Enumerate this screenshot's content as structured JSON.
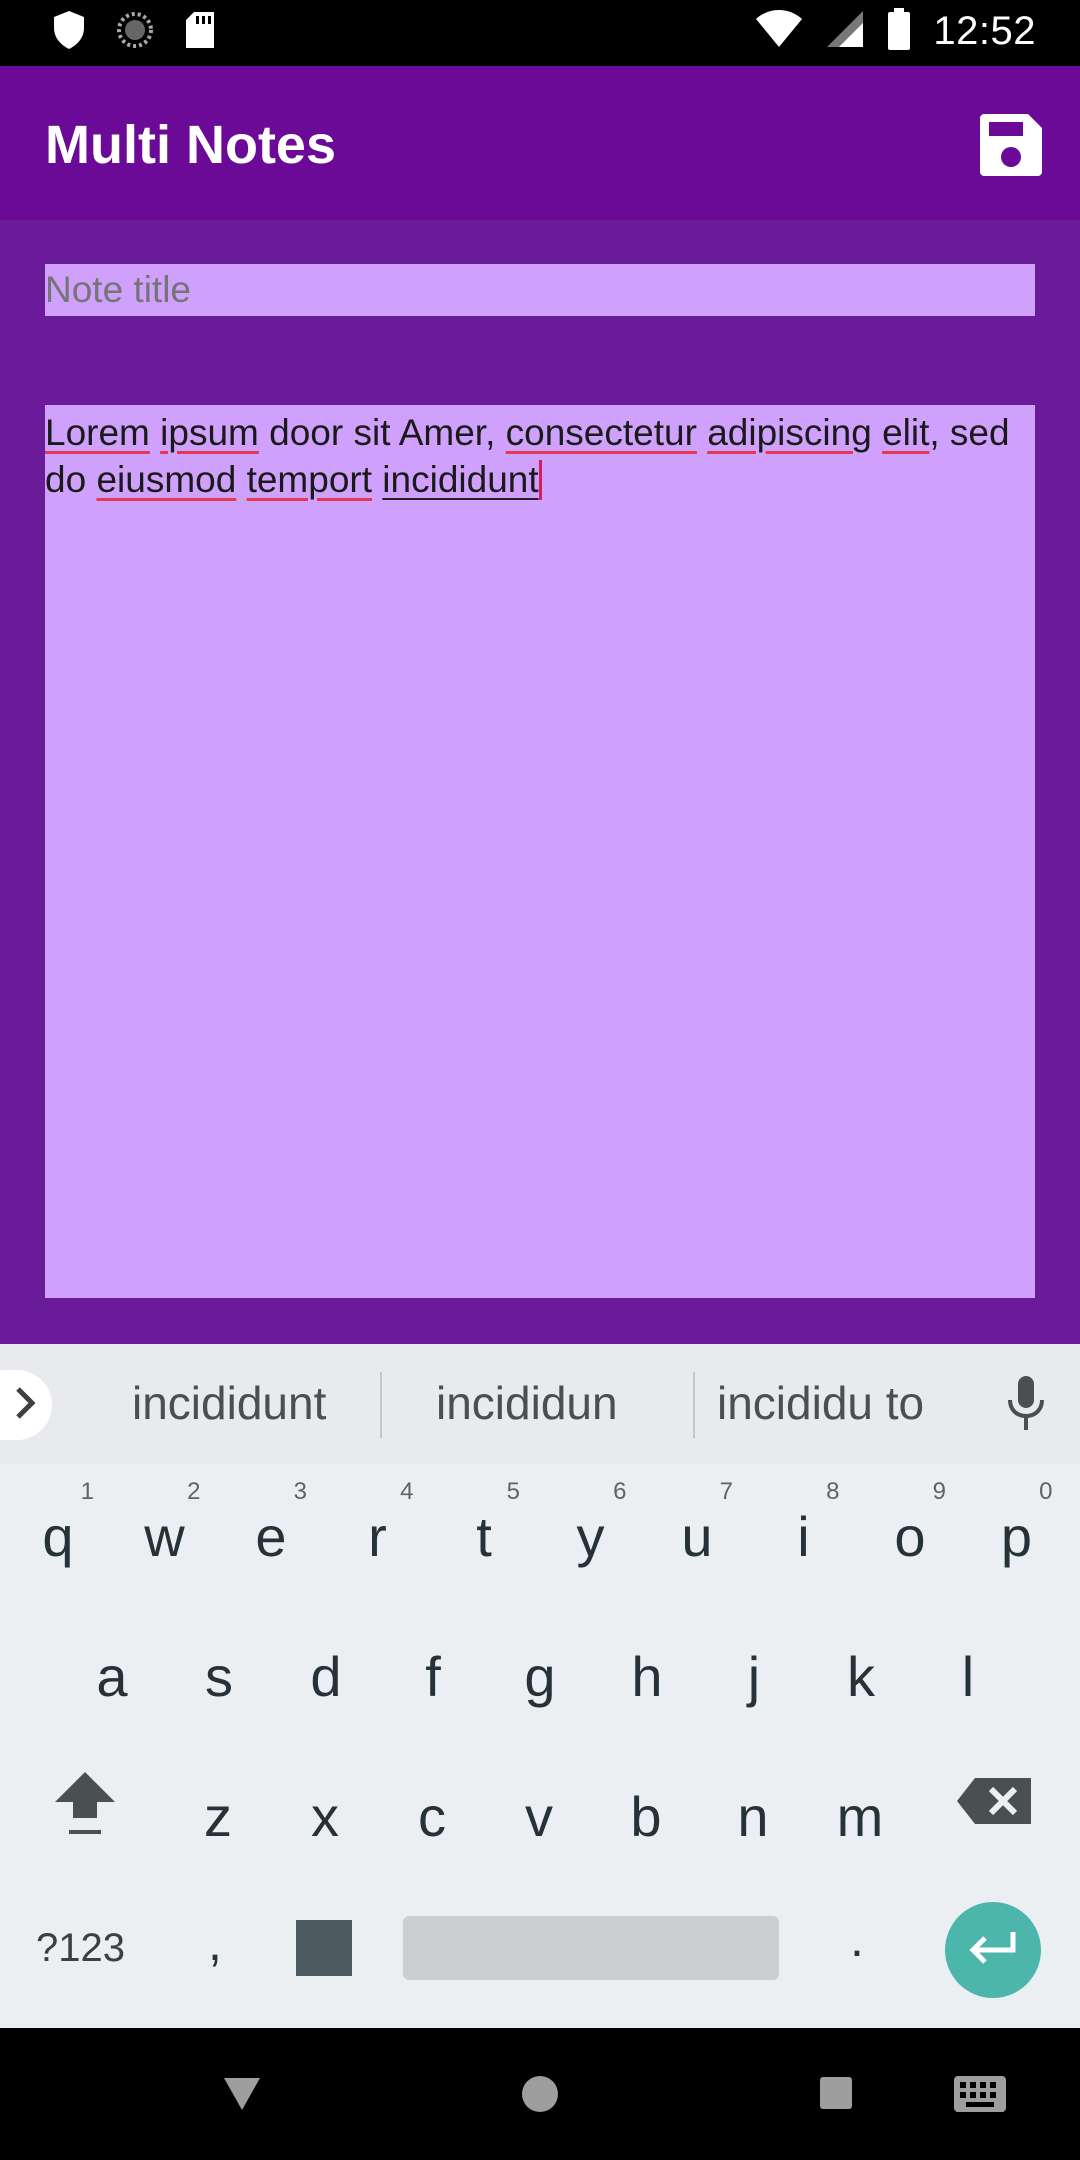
{
  "status_bar": {
    "time": "12:52",
    "icons": [
      "shield-icon",
      "sync-icon",
      "sd-card-icon",
      "wifi-icon",
      "signal-icon",
      "battery-icon"
    ]
  },
  "app_bar": {
    "title": "Multi Notes",
    "save_icon": "save-icon"
  },
  "note": {
    "title_placeholder": "Note title",
    "title_value": "",
    "body_words": [
      {
        "text": "Lorem",
        "style": "spell"
      },
      {
        "text": " ",
        "style": ""
      },
      {
        "text": "ipsum",
        "style": "spell"
      },
      {
        "text": " door sit Amer, ",
        "style": ""
      },
      {
        "text": "consectetur",
        "style": "spell"
      },
      {
        "text": " ",
        "style": ""
      },
      {
        "text": "adipiscing",
        "style": "spell"
      },
      {
        "text": " ",
        "style": ""
      },
      {
        "text": "elit",
        "style": "spell"
      },
      {
        "text": ", sed do ",
        "style": ""
      },
      {
        "text": "eiusmod",
        "style": "spell"
      },
      {
        "text": " ",
        "style": ""
      },
      {
        "text": "temport",
        "style": "spell"
      },
      {
        "text": " ",
        "style": ""
      },
      {
        "text": "incididunt",
        "style": "compose"
      }
    ]
  },
  "keyboard": {
    "suggestions": [
      "incididunt",
      "incididun",
      "incididu to"
    ],
    "row1": [
      {
        "key": "q",
        "hint": "1"
      },
      {
        "key": "w",
        "hint": "2"
      },
      {
        "key": "e",
        "hint": "3"
      },
      {
        "key": "r",
        "hint": "4"
      },
      {
        "key": "t",
        "hint": "5"
      },
      {
        "key": "y",
        "hint": "6"
      },
      {
        "key": "u",
        "hint": "7"
      },
      {
        "key": "i",
        "hint": "8"
      },
      {
        "key": "o",
        "hint": "9"
      },
      {
        "key": "p",
        "hint": "0"
      }
    ],
    "row2": [
      "a",
      "s",
      "d",
      "f",
      "g",
      "h",
      "j",
      "k",
      "l"
    ],
    "row3": [
      "z",
      "x",
      "c",
      "v",
      "b",
      "n",
      "m"
    ],
    "symbols_label": "?123",
    "comma_label": ",",
    "period_label": "."
  },
  "colors": {
    "app_bar": "#6a0a96",
    "background": "#6a1b9a",
    "field": "#cfa1fc",
    "enter_key": "#4db6ac"
  }
}
